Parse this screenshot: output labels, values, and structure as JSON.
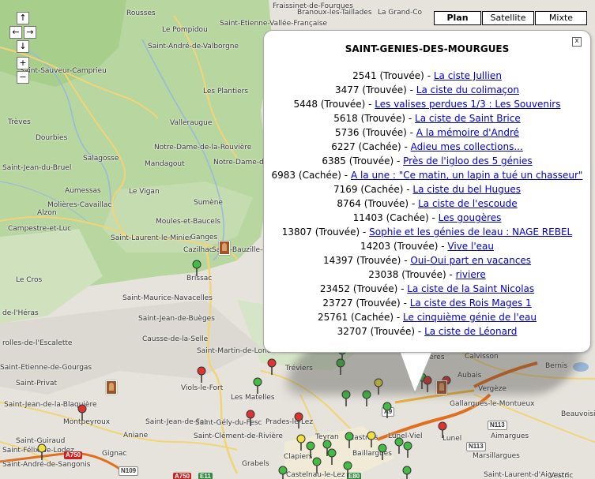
{
  "map_type": {
    "buttons": [
      "Plan",
      "Satellite",
      "Mixte"
    ],
    "active": "Plan"
  },
  "nav": {
    "up": "↑",
    "left": "←",
    "right": "→",
    "down": "↓",
    "zoom_in": "+",
    "zoom_out": "−"
  },
  "places": [
    "Fraissinet-de-Fourques",
    "Rousses",
    "Branoux-les-Taillades",
    "La Grand-Co",
    "Le Pompidou",
    "Saint-Etienne-Vallée-Française",
    "Saint-André-de-Valborgne",
    "Saint-Sauveur-Camprieu",
    "Les Plantiers",
    "Trèves",
    "Valleraugue",
    "Dourbies",
    "Notre-Dame-de-la-Rouvière",
    "Salagosse",
    "Mandagout",
    "Saint-Jean-du-Bruel",
    "Notre-Dame-de-Majenc",
    "Aumessas",
    "Le Vigan",
    "Sumène",
    "Molières-Cavaillac",
    "Alzon",
    "Campestre-et-Luc",
    "Moules-et-Baucels",
    "Saint-Laurent-le-Minier",
    "Ganges",
    "Cazilhac",
    "Saint-Bauzille-de-Putois",
    "Brissac",
    "Le Cros",
    "Saint-Maurice-Navacelles",
    "de-l'Héras",
    "Saint-Jean-de-Buèges",
    "Causse-de-la-Selle",
    "Saint-Martin-de-Londres",
    "rolles-de-l'Escalette",
    "Saint-Etienne-de-Gourgas",
    "Saint-Privat",
    "Saint-Jean-de-la-Blaquière",
    "Viols-le-Fort",
    "Les Matelles",
    "Tréviers",
    "Montpeyroux",
    "Saint-Jean-de-Fos",
    "Saint-Gély-du-Fesc",
    "Prades-le-Lez",
    "Aniane",
    "Saint-Clément-de-Rivière",
    "Saint-Guiraud",
    "Saint-Félix-de-Lodez",
    "Saint-André-de-Sangonis",
    "Gignac",
    "Grabels",
    "Clapiers",
    "Teyran",
    "Castries",
    "Baillargues",
    "Lunel-Viel",
    "Lunel",
    "Castelnau-le-Lez",
    "Sommières",
    "Calvisson",
    "Bernis",
    "Vergèze",
    "Gallargues-le-Montueux",
    "Aubais",
    "Aimargues",
    "Beauvoisin",
    "Marsillargues",
    "Saint-Laurent-d'Aigouze",
    "Vestric"
  ],
  "roads": [
    "A750",
    "N109",
    "A750",
    "E11",
    "E80",
    "N113",
    "N113",
    "A9"
  ],
  "info_window": {
    "title": "SAINT-GENIES-DES-MOURGUES",
    "close": "x",
    "items": [
      {
        "id": "2541",
        "status": "(Trouvée)",
        "name": "La ciste Jullien"
      },
      {
        "id": "3477",
        "status": "(Trouvée)",
        "name": "La ciste du colimaçon"
      },
      {
        "id": "5448",
        "status": "(Trouvée)",
        "name": "Les valises perdues 1/3 : Les Souvenirs"
      },
      {
        "id": "5618",
        "status": "(Trouvée)",
        "name": "La ciste de Saint Brice"
      },
      {
        "id": "5736",
        "status": "(Trouvée)",
        "name": "A la mémoire d'André"
      },
      {
        "id": "6227",
        "status": "(Cachée)",
        "name": "Adieu mes collections..."
      },
      {
        "id": "6385",
        "status": "(Trouvée)",
        "name": "Près de l'igloo des 5 génies"
      },
      {
        "id": "6983",
        "status": "(Cachée)",
        "name": "A la une : \"Ce matin, un lapin a tué un chasseur\""
      },
      {
        "id": "7169",
        "status": "(Cachée)",
        "name": "La ciste du bel Hugues"
      },
      {
        "id": "8764",
        "status": "(Trouvée)",
        "name": "La ciste de l'escoude"
      },
      {
        "id": "11403",
        "status": "(Cachée)",
        "name": "Les gougères"
      },
      {
        "id": "13807",
        "status": "(Trouvée)",
        "name": "Sophie et les génies de leau : NAGE REBEL"
      },
      {
        "id": "14203",
        "status": "(Trouvée)",
        "name": "Vive l'eau"
      },
      {
        "id": "14397",
        "status": "(Trouvée)",
        "name": "Oui-Oui part en vacances"
      },
      {
        "id": "23038",
        "status": "(Trouvée)",
        "name": "riviere"
      },
      {
        "id": "23452",
        "status": "(Trouvée)",
        "name": "La ciste de la Saint Nicolas"
      },
      {
        "id": "23727",
        "status": "(Trouvée)",
        "name": "La ciste des Rois Mages 1"
      },
      {
        "id": "25761",
        "status": "(Cachée)",
        "name": "Le cinquième génie de l'eau"
      },
      {
        "id": "32707",
        "status": "(Trouvée)",
        "name": "La ciste de Léonard"
      }
    ]
  },
  "colors": {
    "marker_green": "#44bb44",
    "marker_red": "#dd3333",
    "marker_yellow": "#f0e040",
    "link": "#0000cc"
  }
}
